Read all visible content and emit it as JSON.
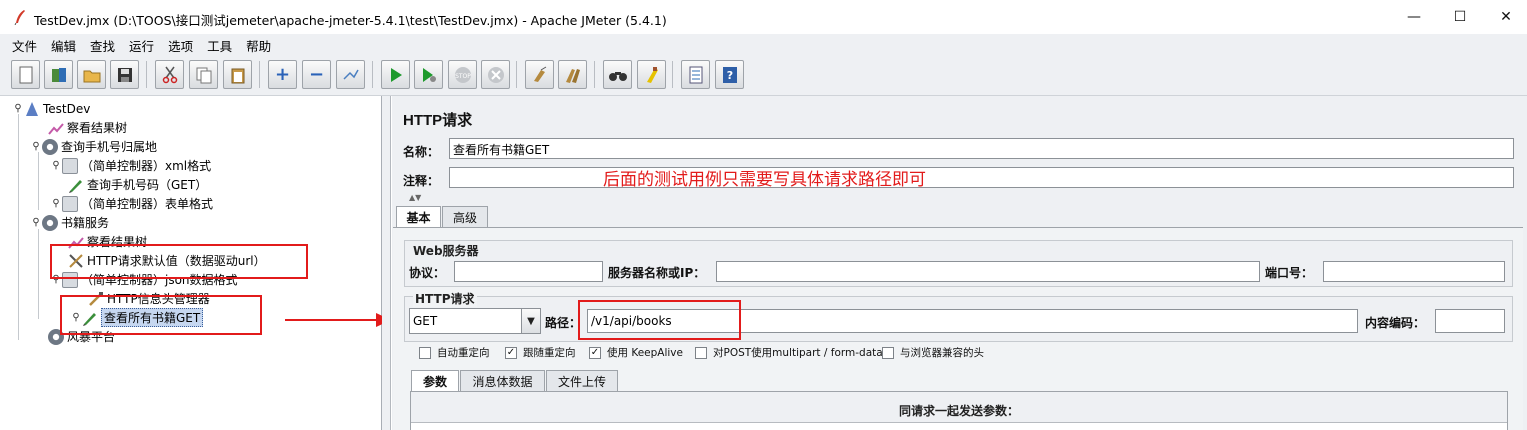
{
  "window": {
    "title": "TestDev.jmx (D:\\TOOS\\接口测试jemeter\\apache-jmeter-5.4.1\\test\\TestDev.jmx) - Apache JMeter (5.4.1)",
    "minimize": "—",
    "maximize": "☐",
    "close": "✕"
  },
  "menu": [
    "文件",
    "编辑",
    "查找",
    "运行",
    "选项",
    "工具",
    "帮助"
  ],
  "toolbar": {
    "icons": [
      "new-icon",
      "templates-icon",
      "open-icon",
      "save-icon",
      "cut-icon",
      "copy-icon",
      "paste-icon",
      "expand-icon",
      "collapse-icon",
      "toggle-icon",
      "start-icon",
      "start-no-pause-icon",
      "stop-icon",
      "shutdown-icon",
      "clear-icon",
      "clear-all-icon",
      "search-icon",
      "reset-search-icon",
      "function-helper-icon",
      "help-icon"
    ]
  },
  "tree": {
    "root": "TestDev",
    "items": [
      "察看结果树",
      "查询手机号归属地",
      "（简单控制器）xml格式",
      "查询手机号码（GET）",
      "（简单控制器）表单格式",
      "书籍服务",
      "察看结果树",
      "HTTP请求默认值（数据驱动url）",
      "（简单控制器）json数据格式",
      "HTTP信息头管理器",
      "查看所有书籍GET",
      "风暴平台"
    ]
  },
  "panel": {
    "title": "HTTP请求",
    "name_label": "名称：",
    "name_value": "查看所有书籍GET",
    "comment_label": "注释：",
    "comment_value": "",
    "annotation": "后面的测试用例只需要写具体请求路径即可",
    "tabs": [
      "基本",
      "高级"
    ],
    "web_server": {
      "title": "Web服务器",
      "protocol_label": "协议：",
      "protocol_value": "",
      "server_label": "服务器名称或IP：",
      "server_value": "",
      "port_label": "端口号：",
      "port_value": ""
    },
    "http_request": {
      "title": "HTTP请求",
      "method": "GET",
      "path_label": "路径：",
      "path_value": "/v1/api/books",
      "encoding_label": "内容编码：",
      "encoding_value": ""
    },
    "checkboxes": [
      {
        "label": "自动重定向",
        "checked": false
      },
      {
        "label": "跟随重定向",
        "checked": true
      },
      {
        "label": "使用 KeepAlive",
        "checked": true
      },
      {
        "label": "对POST使用multipart / form-data",
        "checked": false
      },
      {
        "label": "与浏览器兼容的头",
        "checked": false
      }
    ],
    "sub_tabs": [
      "参数",
      "消息体数据",
      "文件上传"
    ],
    "params_title": "同请求一起发送参数："
  },
  "colors": {
    "accent": "#e21b1b",
    "selection": "#c6d7f0"
  }
}
